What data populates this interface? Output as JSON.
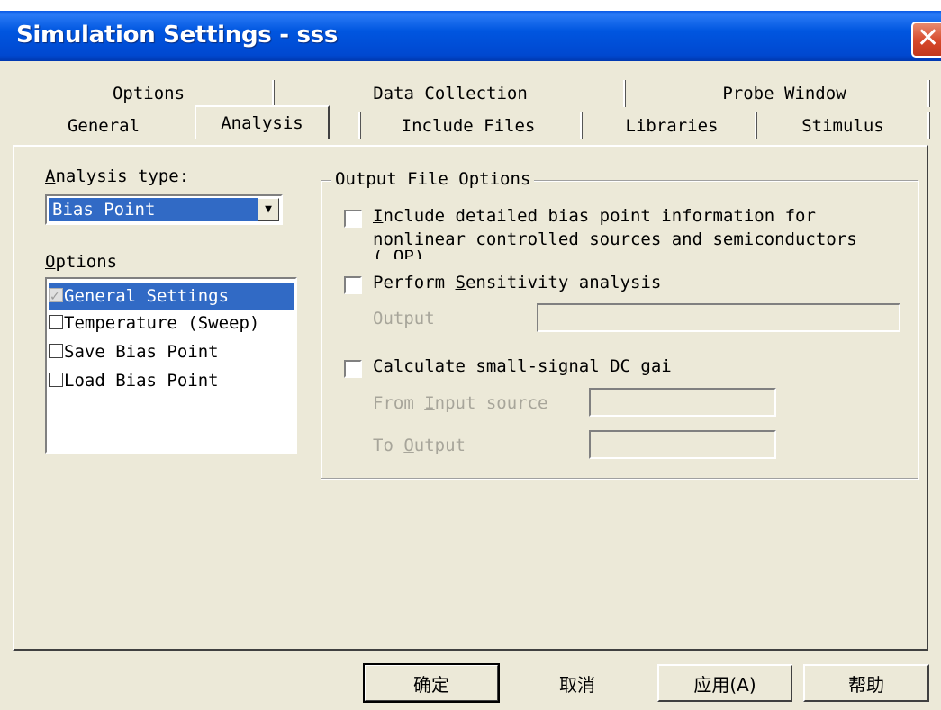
{
  "window": {
    "title": "Simulation Settings - sss",
    "close_glyph": "✕"
  },
  "tabs": {
    "row1": [
      "Options",
      "Data Collection",
      "Probe Window"
    ],
    "row2": [
      "General",
      "Analysis",
      "Include Files",
      "Libraries",
      "Stimulus"
    ],
    "active": "Analysis"
  },
  "analysis": {
    "label_hot": "A",
    "label_rest": "nalysis type:",
    "selected_value": "Bias Point",
    "arrow_glyph": "▼"
  },
  "options": {
    "label_hot": "O",
    "label_rest": "ptions",
    "items": [
      {
        "label": "General Settings",
        "checked": true,
        "selected": true
      },
      {
        "label": "Temperature (Sweep)",
        "checked": false,
        "selected": false
      },
      {
        "label": "Save Bias Point",
        "checked": false,
        "selected": false
      },
      {
        "label": "Load Bias Point",
        "checked": false,
        "selected": false
      }
    ]
  },
  "output_file_options": {
    "title": "Output File Options",
    "detailed_bias": {
      "hot": "I",
      "line1_rest": "nclude detailed bias point information for",
      "line2": "nonlinear controlled sources and semiconductors",
      "line3_partial": "(.OP)"
    },
    "sensitivity": {
      "before": "Perform ",
      "hot": "S",
      "after": "ensitivity analysis",
      "output_label": "Output",
      "output_value": ""
    },
    "dc_gain": {
      "hot": "C",
      "rest": "alculate small-signal DC gai",
      "from_before": "From ",
      "from_hot": "I",
      "from_after": "nput source",
      "from_value": "",
      "to_before": "To ",
      "to_hot": "O",
      "to_after": "utput",
      "to_value": ""
    }
  },
  "buttons": {
    "ok": "确定",
    "cancel": "取消",
    "apply": "应用(A)",
    "help": "帮助"
  }
}
